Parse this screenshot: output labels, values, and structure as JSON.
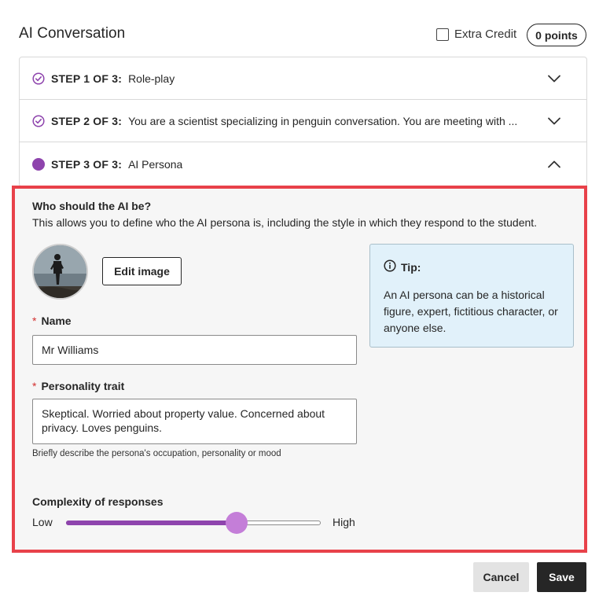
{
  "header": {
    "title": "AI Conversation",
    "extra_credit_label": "Extra Credit",
    "extra_credit_checked": false,
    "points_label": "0 points"
  },
  "steps": [
    {
      "label": "STEP 1 OF 3:",
      "description": "Role-play",
      "status": "complete",
      "status_icon": "check-circle-icon",
      "expanded": false
    },
    {
      "label": "STEP 2 OF 3:",
      "description": "You are a scientist specializing in penguin conversation. You are meeting with ...",
      "status": "complete",
      "status_icon": "check-circle-icon",
      "expanded": false
    },
    {
      "label": "STEP 3 OF 3:",
      "description": "AI Persona",
      "status": "current",
      "status_icon": "filled-circle-icon",
      "expanded": true
    }
  ],
  "persona": {
    "heading": "Who should the AI be?",
    "description": "This allows you to define who the AI persona is, including the style in which they respond to the student.",
    "edit_image_label": "Edit image",
    "tip": {
      "title": "Tip:",
      "body": "An AI persona can be a historical figure, expert, fictitious character, or anyone else."
    },
    "required_marker": "*",
    "name_label": "Name",
    "name_value": "Mr Williams",
    "trait_label": "Personality trait",
    "trait_value": "Skeptical. Worried about property value. Concerned about privacy. Loves penguins.",
    "trait_hint": "Briefly describe the persona's occupation, personality or mood",
    "complexity_label": "Complexity of responses",
    "complexity_low": "Low",
    "complexity_high": "High",
    "complexity_level": 0.67
  },
  "footer": {
    "cancel_label": "Cancel",
    "save_label": "Save"
  },
  "colors": {
    "accent": "#8e44ad",
    "slider_thumb": "#c47ed8",
    "highlight_border": "#e8414a",
    "tip_background": "#e1f1fa",
    "primary_button": "#262626"
  }
}
